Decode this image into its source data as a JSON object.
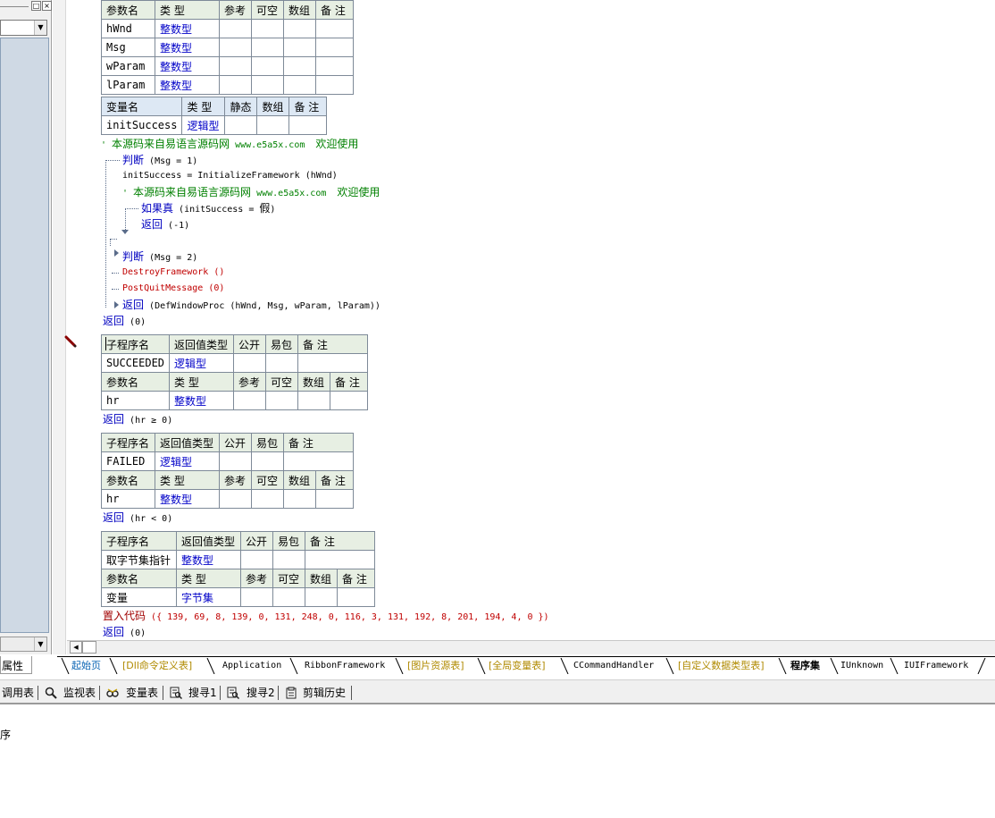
{
  "left_panel": {
    "tab_label": "属性"
  },
  "params_table": {
    "headers": [
      "参数名",
      "类 型",
      "参考",
      "可空",
      "数组",
      "备 注"
    ],
    "rows": [
      [
        "hWnd",
        "整数型"
      ],
      [
        "Msg",
        "整数型"
      ],
      [
        "wParam",
        "整数型"
      ],
      [
        "lParam",
        "整数型"
      ]
    ]
  },
  "vars_table": {
    "headers": [
      "变量名",
      "类 型",
      "静态",
      "数组",
      "备 注"
    ],
    "rows": [
      [
        "initSuccess",
        "逻辑型"
      ]
    ]
  },
  "code": {
    "comment_text": "本源码来自易语言源码网",
    "comment_url": "www.e5a5x.com",
    "comment_tail": "欢迎使用",
    "kw_judge": "判断",
    "kw_ifTrue": "如果真",
    "kw_return": "返回",
    "kw_embed": "置入代码",
    "judge1_cond": "(Msg = 1)",
    "assign": "initSuccess = InitializeFramework (hWnd)",
    "iftrue_cond_a": "(initSuccess =",
    "iftrue_cond_false": "假",
    "iftrue_cond_b": ")",
    "return_neg1": "(-1)",
    "judge2_cond": "(Msg = 2)",
    "destroy_call": "DestroyFramework ()",
    "postquit_call": "PostQuitMessage (0)",
    "return_defproc": "(DefWindowProc (hWnd, Msg, wParam, lParam))",
    "return_0": "(0)",
    "return_ge": "(hr ≥ 0)",
    "return_lt": "(hr < 0)",
    "embed_args": "({ 139, 69, 8, 139, 0, 131, 248, 0, 116, 3, 131, 192, 8, 201, 194, 4, 0 })"
  },
  "sub_succeeded": {
    "headers": [
      "子程序名",
      "返回值类型",
      "公开",
      "易包",
      "备 注"
    ],
    "row": [
      "SUCCEEDED",
      "逻辑型"
    ],
    "param_headers": [
      "参数名",
      "类 型",
      "参考",
      "可空",
      "数组",
      "备 注"
    ],
    "param_row": [
      "hr",
      "整数型"
    ]
  },
  "sub_failed": {
    "headers": [
      "子程序名",
      "返回值类型",
      "公开",
      "易包",
      "备 注"
    ],
    "row": [
      "FAILED",
      "逻辑型"
    ],
    "param_headers": [
      "参数名",
      "类 型",
      "参考",
      "可空",
      "数组",
      "备 注"
    ],
    "param_row": [
      "hr",
      "整数型"
    ]
  },
  "sub_getptr": {
    "headers": [
      "子程序名",
      "返回值类型",
      "公开",
      "易包",
      "备 注"
    ],
    "row": [
      "取字节集指针",
      "整数型"
    ],
    "param_headers": [
      "参数名",
      "类 型",
      "参考",
      "可空",
      "数组",
      "备 注"
    ],
    "param_row": [
      "变量",
      "字节集"
    ]
  },
  "tabs": [
    {
      "label": "起始页"
    },
    {
      "label": "[Dll命令定义表]"
    },
    {
      "label": "Application"
    },
    {
      "label": "RibbonFramework"
    },
    {
      "label": "[图片资源表]"
    },
    {
      "label": "[全局变量表]"
    },
    {
      "label": "CCommandHandler"
    },
    {
      "label": "[自定义数据类型表]"
    },
    {
      "label": "程序集"
    },
    {
      "label": "IUnknown"
    },
    {
      "label": "IUIFramework"
    }
  ],
  "toolbar": {
    "call_table": "调用表",
    "watch_table": "监视表",
    "var_table": "变量表",
    "search1": "搜寻1",
    "search2": "搜寻2",
    "clip_history": "剪辑历史"
  },
  "output": {
    "text": "序"
  }
}
